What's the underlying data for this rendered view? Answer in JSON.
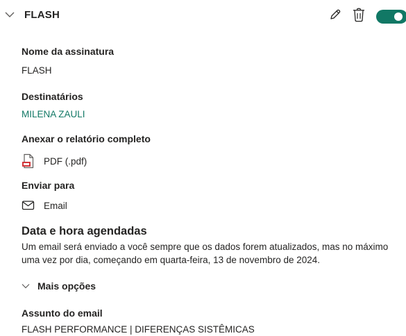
{
  "header": {
    "title": "FLASH",
    "enabled": true,
    "accent_color": "#117865",
    "icons": [
      "chevron-down-icon",
      "edit-pencil-icon",
      "trash-icon",
      "toggle-switch"
    ]
  },
  "subscription_name": {
    "label": "Nome da assinatura",
    "value": "FLASH"
  },
  "recipients": {
    "label": "Destinatários",
    "value": "MILENA ZAULI"
  },
  "attach_report": {
    "label": "Anexar o relatório completo",
    "value": "PDF (.pdf)",
    "icon": "pdf-file-icon"
  },
  "send_to": {
    "label": "Enviar para",
    "value": "Email",
    "icon": "envelope-icon"
  },
  "schedule": {
    "label": "Data e hora agendadas",
    "description": "Um email será enviado a você sempre que os dados forem atualizados, mas no máximo uma vez por dia, começando em quarta-feira, 13 de novembro de 2024."
  },
  "more_options": {
    "label": "Mais opções",
    "icon": "chevron-down-icon"
  },
  "email_subject": {
    "label": "Assunto do email",
    "value": "FLASH PERFORMANCE | DIFERENÇAS SISTÊMICAS"
  }
}
